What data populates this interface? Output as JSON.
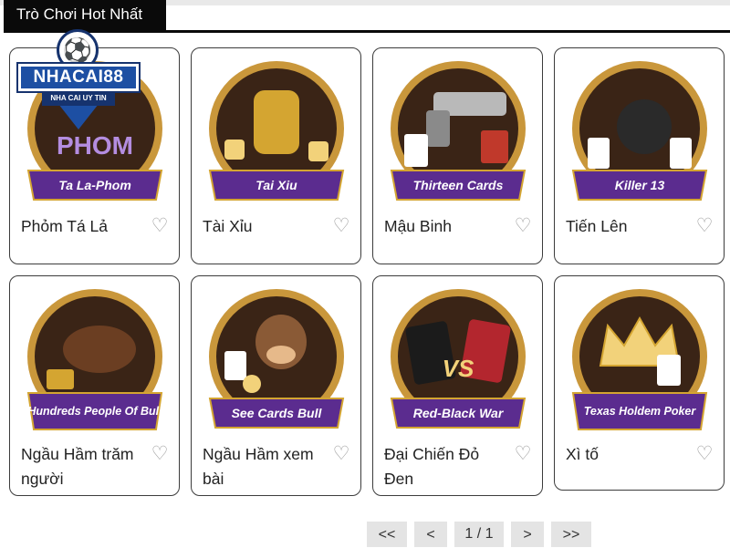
{
  "section": {
    "title": "Trò Chơi Hot Nhất"
  },
  "logo": {
    "brand": "NHACAI88",
    "slogan": "NHA CAI UY TIN"
  },
  "games": [
    {
      "name": "Phỏm Tá Lả",
      "banner": "Ta La-Phom",
      "art_label": "PHOM"
    },
    {
      "name": "Tài Xỉu",
      "banner": "Tai Xiu",
      "art_label": ""
    },
    {
      "name": "Mậu Binh",
      "banner": "Thirteen Cards",
      "art_label": ""
    },
    {
      "name": "Tiến Lên",
      "banner": "Killer 13",
      "art_label": ""
    },
    {
      "name": "Ngầu Hầm trăm người",
      "banner": "Hundreds People Of Bull",
      "art_label": ""
    },
    {
      "name": "Ngầu Hầm xem bài",
      "banner": "See Cards Bull",
      "art_label": ""
    },
    {
      "name": "Đại Chiến Đỏ Đen",
      "banner": "Red-Black War",
      "art_label": "VS"
    },
    {
      "name": "Xì tố",
      "banner": "Texas Holdem Poker",
      "art_label": ""
    }
  ],
  "favorite_icon": "heart-outline-icon",
  "pagination": {
    "first": "<<",
    "prev": "<",
    "page": "1 / 1",
    "next": ">",
    "last": ">>"
  },
  "colors": {
    "header_bg": "#0a0a0a",
    "ribbon": "#5b2c8f",
    "gold": "#d4a531",
    "heart": "#9a9a9a",
    "pager_bg": "#e4e4e4"
  }
}
